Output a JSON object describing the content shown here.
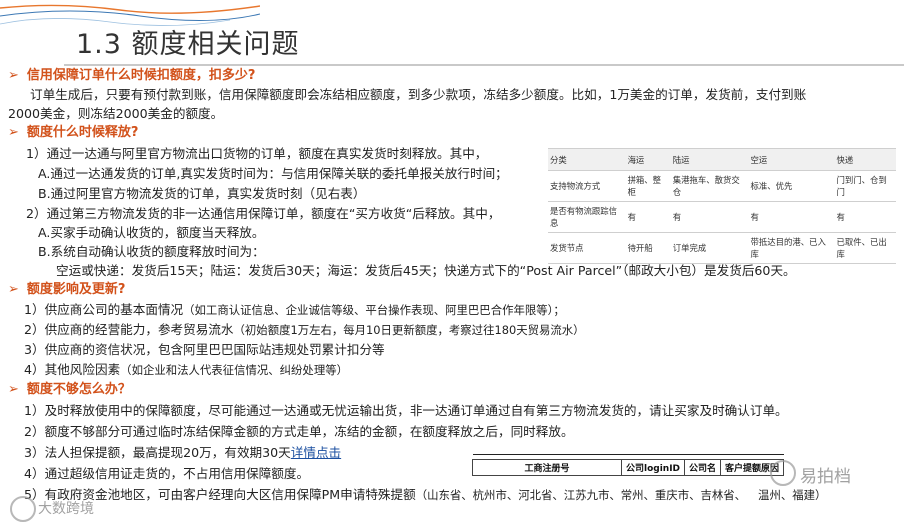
{
  "title": "1.3 额度相关问题",
  "sections": [
    {
      "heading": "信用保障订单什么时候扣额度，扣多少?",
      "lines": [
        "订单生成后，只要有预付款到账，信用保障额度即会冻结相应额度，到多少款项，冻结多少额度。比如，1万美金的订单，发货前，支付到账",
        "2000美金，则冻结2000美金的额度。"
      ]
    },
    {
      "heading": "额度什么时候释放?",
      "lines": [
        "1）通过一达通与阿里官方物流出口货物的订单，额度在真实发货时刻释放。其中，",
        "A.通过一达通发货的订单,真实发货时间为：与信用保障关联的委托单报关放行时间；",
        "B.通过阿里官方物流发货的订单，真实发货时刻（见右表）",
        "2）通过第三方物流发货的非一达通信用保障订单，额度在“买方收货“后释放。其中，",
        "A.买家手动确认收货的，额度当天释放。",
        "B.系统自动确认收货的额度释放时间为：",
        "空运或快递：发货后15天；陆运：发货后30天；海运：发货后45天；快递方式下的“Post Air Parcel”（邮政大小包）是发货后60天。"
      ]
    },
    {
      "heading": "额度影响及更新?",
      "lines": [
        "1）供应商公司的基本面情况",
        "（如工商认证信息、企业诚信等级、平台操作表现、阿里巴巴合作年限等）；",
        "2）供应商的经营能力，参考贸易流水",
        "（初始额度1万左右，每月10日更新额度，考察过往180天贸易流水）",
        "3）供应商的资信状况，包含阿里巴巴国际站违规处罚累计扣分等",
        "4）其他风险因素",
        "（如企业和法人代表征信情况、纠纷处理等）"
      ]
    },
    {
      "heading": "额度不够怎么办？",
      "lines": [
        "1）及时释放使用中的保障额度，尽可能通过一达通或无忧运输出货，非一达通订单通过自有第三方物流发货的，请让买家及时确认订单。",
        "2）额度不够部分可通过临时冻结保障金额的方式走单，冻结的金额，在额度释放之后，同时释放。",
        "3）法人担保提额，最高提现20万，有效期30天",
        "详情点击",
        "4）通过超级信用证走货的，不占用信用保障额度。",
        "5）有政府资金池地区，可由客户经理向大区信用保障PM申请特殊提额",
        "（山东省、杭州市、河北省、江苏九市、常州、重庆市、吉林省、",
        "温州、福建）"
      ]
    }
  ],
  "logistics_table": {
    "headers": [
      "分类",
      "海运",
      "陆运",
      "空运",
      "快递"
    ],
    "rows": [
      [
        "支持物流方式",
        "拼箱、整柜",
        "集港拖车、散货交仓",
        "标准、优先",
        "门到门、仓到门"
      ],
      [
        "是否有物流跟踪信息",
        "有",
        "有",
        "有",
        "有"
      ],
      [
        "发货节点",
        "待开船",
        "订单完成",
        "带抵达目的港、已入库",
        "已取件、已出库"
      ]
    ]
  },
  "register_table": {
    "headers": [
      "工商注册号",
      "公司loginID",
      "公司名",
      "客户提额原因"
    ]
  },
  "watermarks": {
    "bottom_left": "大数跨境",
    "bottom_right": "易拍档"
  },
  "colors": {
    "heading": "#d2521b",
    "deco_orange": "#e8772e",
    "deco_blue": "#3c78b4",
    "link": "#1b4fa0"
  }
}
